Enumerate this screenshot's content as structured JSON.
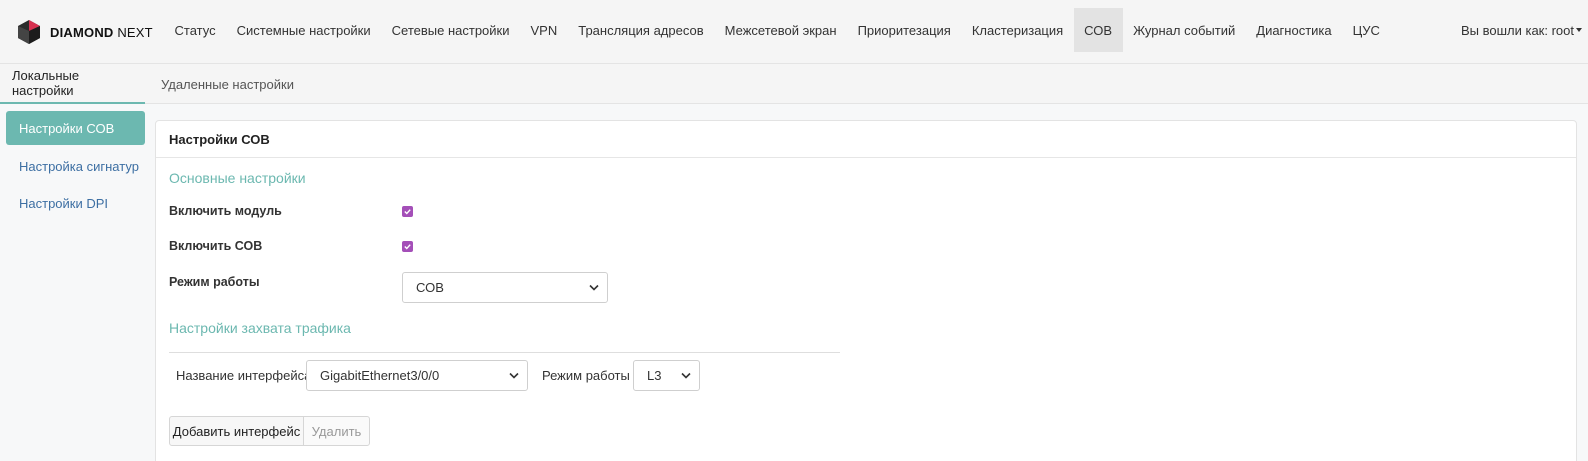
{
  "brand": {
    "name_bold": "DIAMOND",
    "name_light": "NEXT"
  },
  "nav": [
    {
      "label": "Статус"
    },
    {
      "label": "Системные настройки"
    },
    {
      "label": "Сетевые настройки"
    },
    {
      "label": "VPN"
    },
    {
      "label": "Трансляция адресов"
    },
    {
      "label": "Межсетевой экран"
    },
    {
      "label": "Приоритезация"
    },
    {
      "label": "Кластеризация"
    },
    {
      "label": "СОВ",
      "active": true
    },
    {
      "label": "Журнал событий"
    },
    {
      "label": "Диагностика"
    },
    {
      "label": "ЦУС"
    }
  ],
  "user": {
    "label": "Вы вошли как: root"
  },
  "subtabs": [
    {
      "label": "Локальные настройки",
      "active": true
    },
    {
      "label": "Удаленные настройки"
    }
  ],
  "sidebar": {
    "items": [
      {
        "label": "Настройки СОВ",
        "active": true
      },
      {
        "label": "Настройка сигнатур"
      },
      {
        "label": "Настройки DPI"
      }
    ]
  },
  "panel": {
    "title": "Настройки СОВ",
    "main_section": "Основные настройки",
    "enable_module": {
      "label": "Включить модуль",
      "checked": true
    },
    "enable_ids": {
      "label": "Включить СОВ",
      "checked": true
    },
    "mode": {
      "label": "Режим работы",
      "value": "СОВ"
    },
    "capture_section": "Настройки захвата трафика",
    "interface": {
      "label": "Название интерфейса",
      "value": "GigabitEthernet3/0/0"
    },
    "iface_mode": {
      "label": "Режим работы",
      "value": "L3"
    },
    "add_button": "Добавить интерфейс",
    "delete_button": "Удалить"
  },
  "colors": {
    "accent": "#6cb8b0",
    "checkbox": "#a44fb8",
    "link": "#3d6fa3"
  }
}
